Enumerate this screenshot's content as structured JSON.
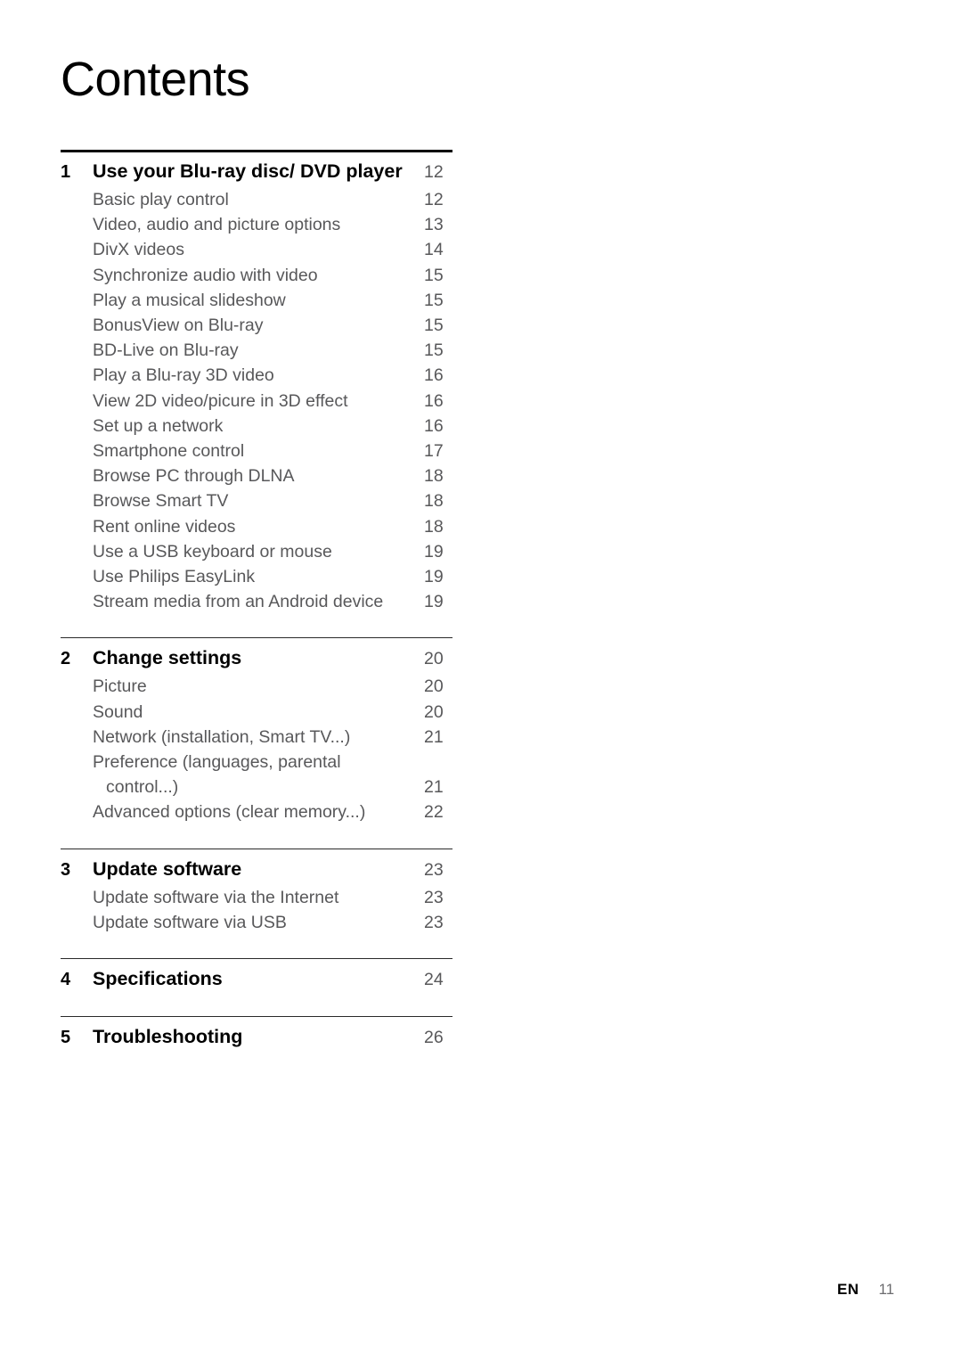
{
  "document": {
    "title": "Contents"
  },
  "sections": [
    {
      "number": "1",
      "title": "Use your Blu-ray disc/ DVD player",
      "page": "12",
      "rule": "thick",
      "items": [
        {
          "label": "Basic play control",
          "page": "12"
        },
        {
          "label": "Video, audio and picture options",
          "page": "13"
        },
        {
          "label": "DivX videos",
          "page": "14"
        },
        {
          "label": "Synchronize audio with video",
          "page": "15"
        },
        {
          "label": "Play a musical slideshow",
          "page": "15"
        },
        {
          "label": "BonusView on Blu-ray",
          "page": "15"
        },
        {
          "label": "BD-Live on Blu-ray",
          "page": "15"
        },
        {
          "label": "Play a Blu-ray 3D video",
          "page": "16"
        },
        {
          "label": "View 2D video/picure in 3D effect",
          "page": "16"
        },
        {
          "label": "Set up a network",
          "page": "16"
        },
        {
          "label": "Smartphone control",
          "page": "17"
        },
        {
          "label": "Browse PC through DLNA",
          "page": "18"
        },
        {
          "label": "Browse Smart TV",
          "page": "18"
        },
        {
          "label": "Rent online videos",
          "page": "18"
        },
        {
          "label": "Use a USB keyboard or mouse",
          "page": "19"
        },
        {
          "label": "Use Philips EasyLink",
          "page": "19"
        },
        {
          "label": "Stream media from an Android device",
          "page": "19"
        }
      ]
    },
    {
      "number": "2",
      "title": "Change settings",
      "page": "20",
      "rule": "thin",
      "items": [
        {
          "label": "Picture",
          "page": "20"
        },
        {
          "label": "Sound",
          "page": "20"
        },
        {
          "label": "Network (installation, Smart TV...)",
          "page": "21"
        },
        {
          "label": "Preference (languages, parental",
          "continuation": "control...)",
          "page": "21"
        },
        {
          "label": "Advanced options (clear memory...)",
          "page": "22"
        }
      ]
    },
    {
      "number": "3",
      "title": "Update software",
      "page": "23",
      "rule": "thin",
      "items": [
        {
          "label": "Update software via the Internet",
          "page": "23"
        },
        {
          "label": "Update software via USB",
          "page": "23"
        }
      ]
    },
    {
      "number": "4",
      "title": "Specifications",
      "page": "24",
      "rule": "thin",
      "items": []
    },
    {
      "number": "5",
      "title": "Troubleshooting",
      "page": "26",
      "rule": "thin",
      "items": []
    }
  ],
  "footer": {
    "language": "EN",
    "page_number": "11"
  }
}
